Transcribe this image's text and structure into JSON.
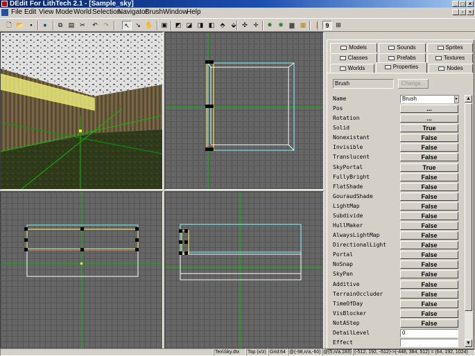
{
  "window": {
    "title": "DEdit For LithTech 2.1 - [Sample_sky]",
    "min": "_",
    "max": "□",
    "close": "×",
    "restore": "▫"
  },
  "menu": [
    "File",
    "Edit",
    "View",
    "Mode",
    "World",
    "Selection",
    "Navigator",
    "Brush",
    "Window",
    "Help"
  ],
  "toolbar": {
    "active_tool": "9"
  },
  "panel": {
    "tabs_row1": [
      "Models",
      "Sounds",
      "Sprites"
    ],
    "tabs_row2": [
      "Classes",
      "Prefabs",
      "Textures"
    ],
    "tabs_row3": [
      "Worlds",
      "Properties",
      "Nodes"
    ],
    "active_tab": "Properties",
    "object_class": "Brush",
    "change_button": "Change...",
    "properties": [
      {
        "name": "Name",
        "value": "Brush",
        "type": "field"
      },
      {
        "name": "Pos",
        "value": "...",
        "type": "button"
      },
      {
        "name": "Rotation",
        "value": "...",
        "type": "button"
      },
      {
        "name": "Solid",
        "value": "True",
        "type": "button"
      },
      {
        "name": "Nonexistant",
        "value": "False",
        "type": "button"
      },
      {
        "name": "Invisible",
        "value": "False",
        "type": "button"
      },
      {
        "name": "Translucent",
        "value": "False",
        "type": "button"
      },
      {
        "name": "SkyPortal",
        "value": "True",
        "type": "button"
      },
      {
        "name": "FullyBright",
        "value": "False",
        "type": "button"
      },
      {
        "name": "FlatShade",
        "value": "False",
        "type": "button"
      },
      {
        "name": "GouraudShade",
        "value": "False",
        "type": "button"
      },
      {
        "name": "LightMap",
        "value": "False",
        "type": "button"
      },
      {
        "name": "Subdivide",
        "value": "False",
        "type": "button"
      },
      {
        "name": "HullMaker",
        "value": "False",
        "type": "button"
      },
      {
        "name": "AlwaysLightMap",
        "value": "False",
        "type": "button"
      },
      {
        "name": "DirectionalLight",
        "value": "False",
        "type": "button"
      },
      {
        "name": "Portal",
        "value": "False",
        "type": "button"
      },
      {
        "name": "NoSnap",
        "value": "False",
        "type": "button"
      },
      {
        "name": "SkyPan",
        "value": "False",
        "type": "button"
      },
      {
        "name": "Additive",
        "value": "False",
        "type": "button"
      },
      {
        "name": "TerrainOccluder",
        "value": "False",
        "type": "button"
      },
      {
        "name": "TimeOfDay",
        "value": "False",
        "type": "button"
      },
      {
        "name": "VisBlocker",
        "value": "False",
        "type": "button"
      },
      {
        "name": "NotAStep",
        "value": "False",
        "type": "button"
      },
      {
        "name": "DetailLevel",
        "value": "0",
        "type": "field"
      },
      {
        "name": "Effect",
        "value": "",
        "type": "field"
      }
    ]
  },
  "status": {
    "texture": "Tex\\Sky.dtx",
    "view": "Top (x/z)",
    "grid": "Grid:64",
    "coords1": "@(-98,n/a,-60)",
    "coords2": "@(5,n/a,183)",
    "extents": "(-512, 192, -512)->(-448, 384, 512) = (64, 192, 1024)"
  },
  "colors": {
    "accent": "#0a246a",
    "grid": "#666666",
    "axis": "#00c000",
    "selection": "#ffff60",
    "brush": "#80ffff"
  }
}
